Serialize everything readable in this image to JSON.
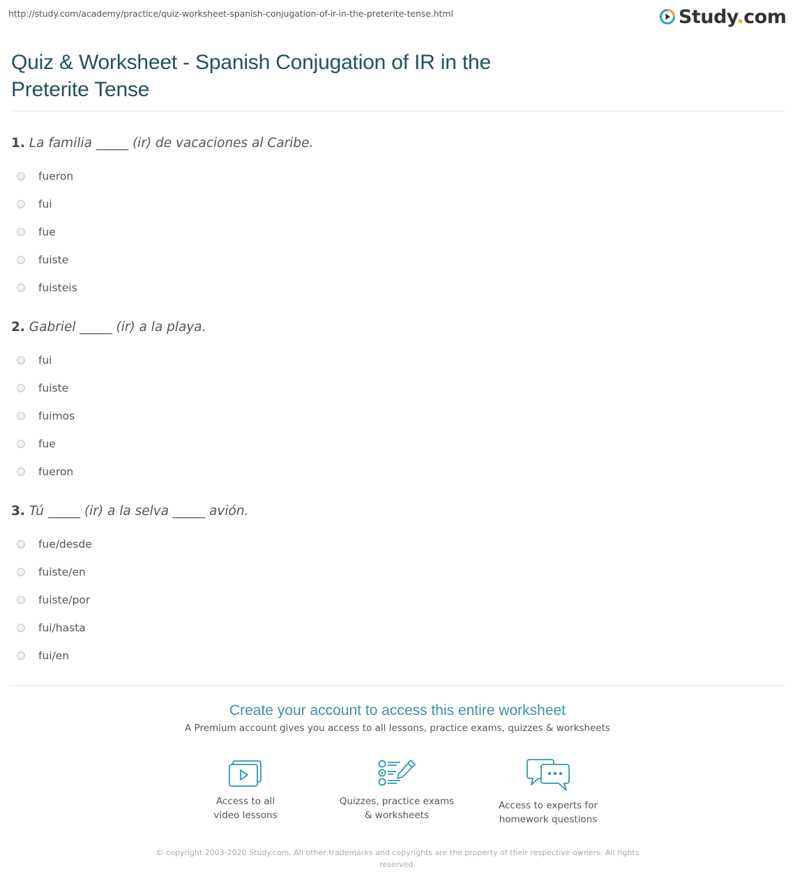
{
  "header": {
    "url": "http://study.com/academy/practice/quiz-worksheet-spanish-conjugation-of-ir-in-the-preterite-tense.html",
    "logo_text_main": "Study",
    "logo_text_dot": ".",
    "logo_text_tld": "com",
    "logo_icon": "play-circle-icon"
  },
  "page_title": "Quiz & Worksheet - Spanish Conjugation of IR in the Preterite Tense",
  "questions": [
    {
      "number": "1.",
      "text": "La familia _____ (ir) de vacaciones al Caribe.",
      "options": [
        "fueron",
        "fui",
        "fue",
        "fuiste",
        "fuisteis"
      ]
    },
    {
      "number": "2.",
      "text": "Gabriel _____ (ir) a la playa.",
      "options": [
        "fui",
        "fuiste",
        "fuimos",
        "fue",
        "fueron"
      ]
    },
    {
      "number": "3.",
      "text": "Tú _____ (ir) a la selva _____ avión.",
      "options": [
        "fue/desde",
        "fuiste/en",
        "fuiste/por",
        "fui/hasta",
        "fui/en"
      ]
    }
  ],
  "cta": {
    "title": "Create your account to access this entire worksheet",
    "subtitle": "A Premium account gives you access to all lessons, practice exams, quizzes & worksheets"
  },
  "features": [
    {
      "icon": "video-lessons-icon",
      "label": "Access to all\nvideo lessons"
    },
    {
      "icon": "quiz-checklist-icon",
      "label": "Quizzes, practice exams\n& worksheets"
    },
    {
      "icon": "chat-bubbles-icon",
      "label": "Access to experts for\nhomework questions"
    }
  ],
  "footer": {
    "copyright": "© copyright 2003-2020 Study.com. All other trademarks and copyrights are the property of their respective owners. All rights reserved."
  },
  "colors": {
    "title": "#23515c",
    "accent": "#3a93a5",
    "logo_orange": "#f6a623",
    "logo_blue": "#2ea3c4"
  }
}
